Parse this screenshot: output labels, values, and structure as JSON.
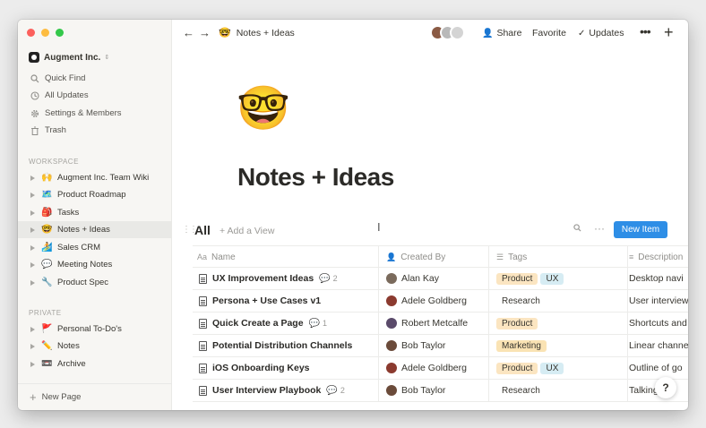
{
  "window": {
    "traffic_colors": [
      "#fc605c",
      "#fdbc40",
      "#34c84a"
    ]
  },
  "sidebar": {
    "workspace_name": "Augment Inc.",
    "nav": [
      {
        "label": "Quick Find",
        "icon": "magnifier-icon"
      },
      {
        "label": "All Updates",
        "icon": "clock-icon"
      },
      {
        "label": "Settings & Members",
        "icon": "gear-icon"
      },
      {
        "label": "Trash",
        "icon": "trash-icon"
      }
    ],
    "workspace_label": "WORKSPACE",
    "workspace_pages": [
      {
        "emoji": "🙌",
        "label": "Augment Inc. Team Wiki"
      },
      {
        "emoji": "🗺️",
        "label": "Product Roadmap"
      },
      {
        "emoji": "🎒",
        "label": "Tasks"
      },
      {
        "emoji": "🤓",
        "label": "Notes + Ideas",
        "active": true
      },
      {
        "emoji": "🏄",
        "label": "Sales CRM"
      },
      {
        "emoji": "💬",
        "label": "Meeting Notes"
      },
      {
        "emoji": "🔧",
        "label": "Product Spec"
      }
    ],
    "private_label": "PRIVATE",
    "private_pages": [
      {
        "emoji": "🚩",
        "label": "Personal To-Do's"
      },
      {
        "emoji": "✏️",
        "label": "Notes"
      },
      {
        "emoji": "📼",
        "label": "Archive"
      }
    ],
    "new_page": "New Page"
  },
  "topbar": {
    "back_icon": "arrow-left-icon",
    "forward_icon": "arrow-right-icon",
    "breadcrumb_emoji": "🤓",
    "breadcrumb": "Notes + Ideas",
    "share": "Share",
    "favorite": "Favorite",
    "updates": "Updates"
  },
  "page": {
    "icon": "🤓",
    "title": "Notes + Ideas"
  },
  "database": {
    "view": "All",
    "add_view": "+ Add a View",
    "new_item": "New Item",
    "accent": "#2e8ee6",
    "columns": [
      {
        "label": "Name",
        "icon": "Aa"
      },
      {
        "label": "Created By",
        "icon": "👤"
      },
      {
        "label": "Tags",
        "icon": "☰"
      },
      {
        "label": "Description",
        "icon": "≡"
      }
    ],
    "rows": [
      {
        "name": "UX Improvement Ideas",
        "comments": "2",
        "author": "Alan Kay",
        "tags": [
          "Product",
          "UX"
        ],
        "desc": "Desktop navi"
      },
      {
        "name": "Persona + Use Cases v1",
        "comments": "",
        "author": "Adele Goldberg",
        "tags": [
          "Research"
        ],
        "desc": "User interview"
      },
      {
        "name": "Quick Create a Page",
        "comments": "1",
        "author": "Robert Metcalfe",
        "tags": [
          "Product"
        ],
        "desc": "Shortcuts and"
      },
      {
        "name": "Potential Distribution Channels",
        "comments": "",
        "author": "Bob Taylor",
        "tags": [
          "Marketing"
        ],
        "desc": "Linear channe"
      },
      {
        "name": "iOS Onboarding Keys",
        "comments": "",
        "author": "Adele Goldberg",
        "tags": [
          "Product",
          "UX"
        ],
        "desc": "Outline of go"
      },
      {
        "name": "User Interview Playbook",
        "comments": "2",
        "author": "Bob Taylor",
        "tags": [
          "Research"
        ],
        "desc": "Talking int"
      }
    ],
    "tag_colors": {
      "Product": "#fbe5c1",
      "UX": "#d6ecf3",
      "Research": "#ffffff",
      "Marketing": "#fae3b4"
    }
  },
  "help": "?"
}
